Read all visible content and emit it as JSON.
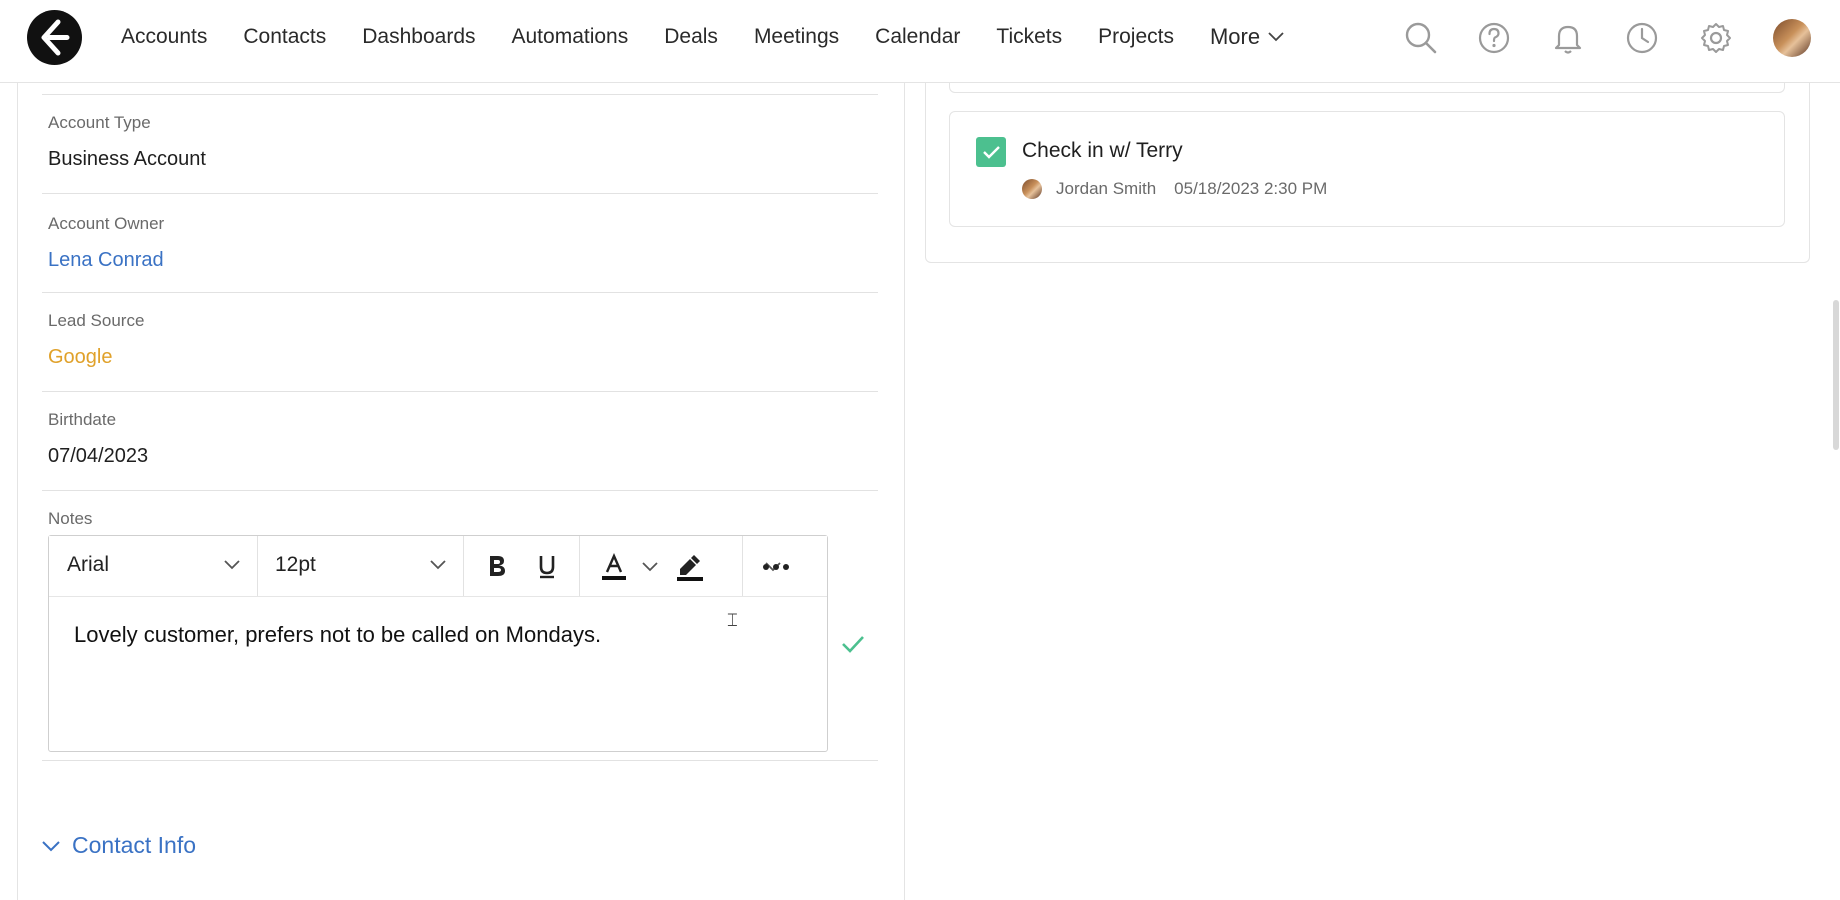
{
  "nav": {
    "items": [
      "Accounts",
      "Contacts",
      "Dashboards",
      "Automations",
      "Deals",
      "Meetings",
      "Calendar",
      "Tickets",
      "Projects"
    ],
    "more_label": "More",
    "icons": [
      "search-icon",
      "help-icon",
      "bell-icon",
      "clock-icon",
      "gear-icon"
    ]
  },
  "fields": {
    "account_type": {
      "label": "Account Type",
      "value": "Business Account"
    },
    "account_owner": {
      "label": "Account Owner",
      "value": "Lena Conrad"
    },
    "lead_source": {
      "label": "Lead Source",
      "value": "Google"
    },
    "birthdate": {
      "label": "Birthdate",
      "value": "07/04/2023"
    },
    "notes": {
      "label": "Notes"
    }
  },
  "editor": {
    "font": "Arial",
    "size": "12pt",
    "content": "Lovely customer, prefers not to be called on Mondays."
  },
  "sections": {
    "contact_info": "Contact Info"
  },
  "task": {
    "title": "Check in w/ Terry",
    "owner": "Jordan Smith",
    "datetime": "05/18/2023 2:30 PM",
    "completed": true
  },
  "colors": {
    "accent_blue": "#3a72c4",
    "orange": "#e0a12a",
    "green": "#4cc08f"
  }
}
